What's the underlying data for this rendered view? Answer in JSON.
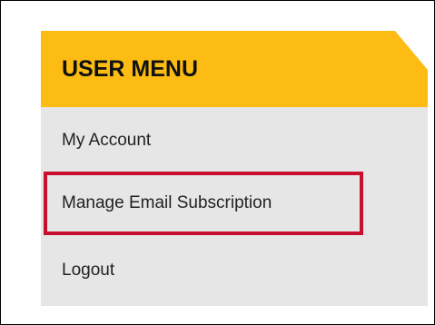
{
  "menu": {
    "title": "USER MENU",
    "items": [
      {
        "label": "My Account"
      },
      {
        "label": "Manage Email Subscription",
        "highlighted": true
      },
      {
        "label": "Logout"
      }
    ]
  },
  "colors": {
    "header_background": "#fcbc13",
    "menu_background": "#e6e6e6",
    "highlight_border": "#c8102e",
    "text": "#222222"
  }
}
